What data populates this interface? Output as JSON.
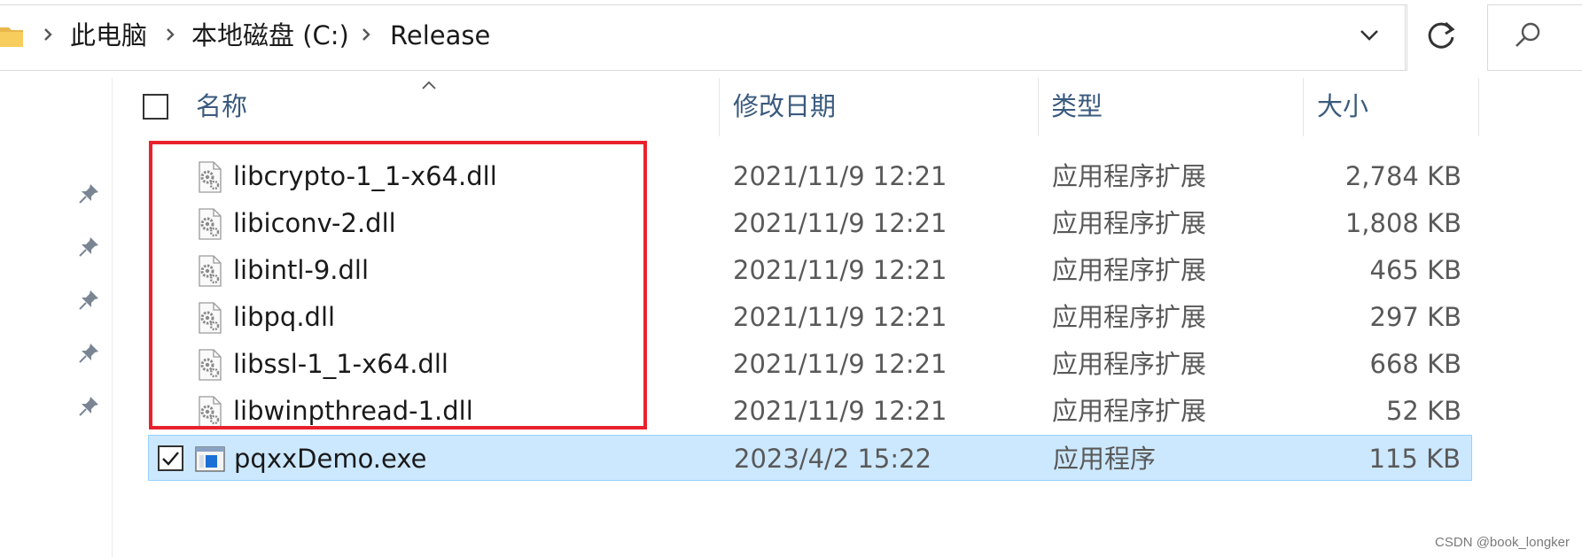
{
  "address_bar": {
    "breadcrumbs": [
      "此电脑",
      "本地磁盘 (C:)",
      "Release"
    ]
  },
  "icons": {
    "folder": "folder-icon",
    "breadcrumb_separator": "chevron-right-icon",
    "address_dropdown": "chevron-down-icon",
    "refresh": "refresh-icon",
    "search": "search-icon",
    "pin": "pin-icon",
    "dll": "dll-gear-icon",
    "exe": "exe-window-icon"
  },
  "columns": {
    "name": "名称",
    "date": "修改日期",
    "type": "类型",
    "size": "大小"
  },
  "files": [
    {
      "name": "libcrypto-1_1-x64.dll",
      "date": "2021/11/9 12:21",
      "type": "应用程序扩展",
      "size": "2,784 KB",
      "kind": "dll",
      "selected": false
    },
    {
      "name": "libiconv-2.dll",
      "date": "2021/11/9 12:21",
      "type": "应用程序扩展",
      "size": "1,808 KB",
      "kind": "dll",
      "selected": false
    },
    {
      "name": "libintl-9.dll",
      "date": "2021/11/9 12:21",
      "type": "应用程序扩展",
      "size": "465 KB",
      "kind": "dll",
      "selected": false
    },
    {
      "name": "libpq.dll",
      "date": "2021/11/9 12:21",
      "type": "应用程序扩展",
      "size": "297 KB",
      "kind": "dll",
      "selected": false
    },
    {
      "name": "libssl-1_1-x64.dll",
      "date": "2021/11/9 12:21",
      "type": "应用程序扩展",
      "size": "668 KB",
      "kind": "dll",
      "selected": false
    },
    {
      "name": "libwinpthread-1.dll",
      "date": "2021/11/9 12:21",
      "type": "应用程序扩展",
      "size": "52 KB",
      "kind": "dll",
      "selected": false
    },
    {
      "name": "pqxxDemo.exe",
      "date": "2023/4/2 15:22",
      "type": "应用程序",
      "size": "115 KB",
      "kind": "exe",
      "selected": true
    }
  ],
  "colors": {
    "selection_bg": "#cce8ff",
    "selection_border": "#99d1ff",
    "highlight_box": "#e8222d",
    "header_text": "#3a5a7e"
  },
  "watermark": "CSDN @book_longker"
}
